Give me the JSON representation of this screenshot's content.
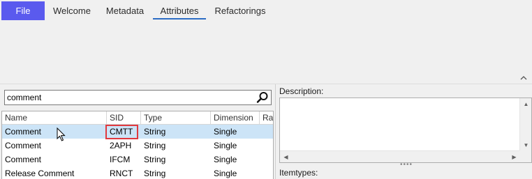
{
  "ribbon": {
    "file_label": "File",
    "tabs": [
      {
        "label": "Welcome"
      },
      {
        "label": "Metadata"
      },
      {
        "label": "Attributes"
      },
      {
        "label": "Refactorings"
      }
    ],
    "active_tab": "Attributes",
    "collapse_icon": "chevron-up-icon"
  },
  "search": {
    "value": "comment",
    "icon": "search-icon"
  },
  "grid": {
    "columns": [
      "Name",
      "SID",
      "Type",
      "Dimension",
      "Ran"
    ],
    "rows": [
      {
        "name": "Comment",
        "sid": "CMTT",
        "type": "String",
        "dimension": "Single",
        "selected": true
      },
      {
        "name": "Comment",
        "sid": "2APH",
        "type": "String",
        "dimension": "Single",
        "selected": false
      },
      {
        "name": "Comment",
        "sid": "IFCM",
        "type": "String",
        "dimension": "Single",
        "selected": false
      },
      {
        "name": "Release Comment",
        "sid": "RNCT",
        "type": "String",
        "dimension": "Single",
        "selected": false
      }
    ],
    "selection_color": "#cce4f7",
    "highlight_color": "#e0393e"
  },
  "details": {
    "description_label": "Description:",
    "itemtypes_label": "Itemtypes:"
  },
  "colors": {
    "file_tab": "#5a5aee",
    "active_underline": "#2b6cc4"
  }
}
